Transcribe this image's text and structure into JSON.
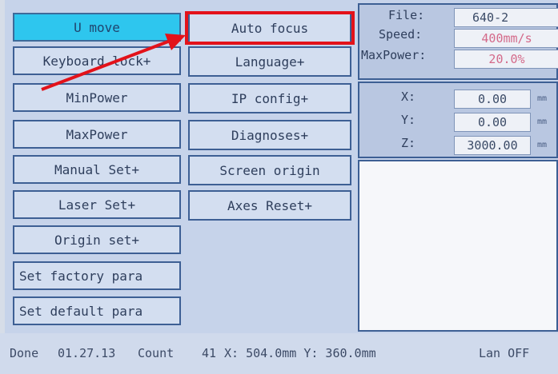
{
  "menu": {
    "u_move": "U move",
    "auto_focus": "Auto focus",
    "keyboard_lock": "Keyboard lock+",
    "language": "Language+",
    "min_power": "MinPower",
    "ip_config": "IP config+",
    "max_power": "MaxPower",
    "diagnoses": "Diagnoses+",
    "manual_set": "Manual Set+",
    "screen_origin": "Screen origin",
    "laser_set": "Laser Set+",
    "axes_reset": "Axes Reset+",
    "origin_set": "Origin set+",
    "set_factory_para": "Set factory para",
    "set_default_para": "Set default para"
  },
  "file_info": {
    "file_label": "File:",
    "file_value": "640-2",
    "speed_label": "Speed:",
    "speed_value": "400mm/s",
    "maxpower_label": "MaxPower:",
    "maxpower_value": "20.0%"
  },
  "coords": {
    "x_label": "X:",
    "x_value": "0.00",
    "y_label": "Y:",
    "y_value": "0.00",
    "z_label": "Z:",
    "z_value": "3000.00",
    "unit": "mm"
  },
  "status_bar": {
    "state": "Done",
    "file_date": "01.27.13",
    "count_label": "Count",
    "count_value": "41",
    "position": "X: 504.0mm Y: 360.0mm",
    "lan": "Lan OFF"
  },
  "colors": {
    "highlight": "#e3121a",
    "active_button": "#2ec6ee",
    "accent_value": "#d46a8a"
  },
  "annotations": {
    "arrow": "red-arrow-icon"
  }
}
